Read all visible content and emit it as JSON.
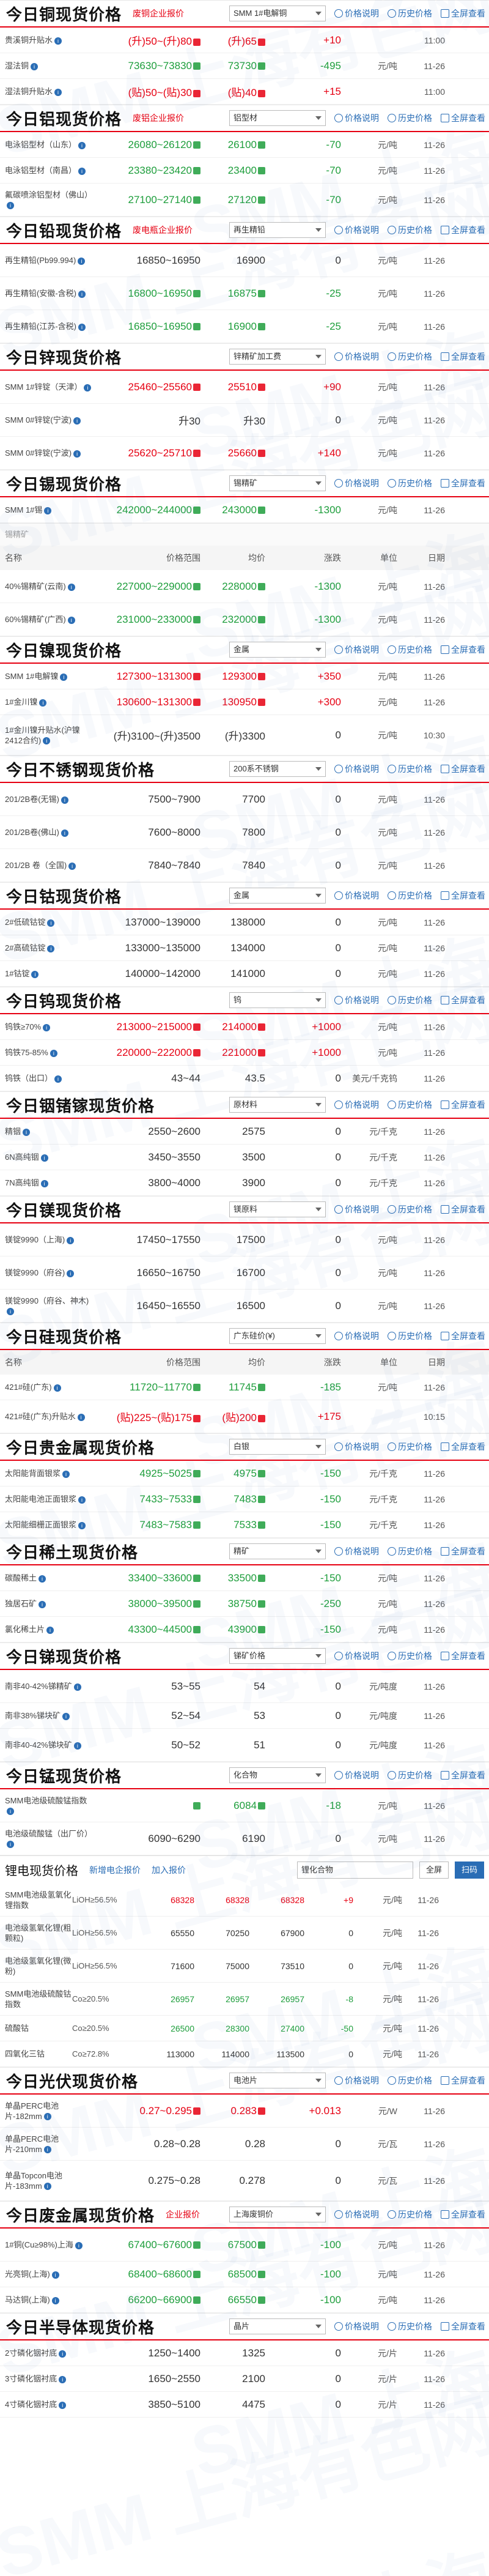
{
  "labels": {
    "price_desc": "价格说明",
    "history": "历史价格",
    "full_view": "全屏查看"
  },
  "sections": [
    {
      "title": "今日铜现货价格",
      "tag": "废铜企业报价",
      "select": "SMM 1#电解铜",
      "hdr": false,
      "rows": [
        {
          "name": "贵溪铜升贴水",
          "range": "(升)50~(升)80",
          "avg": "(升)65",
          "chg": "+10",
          "dir": "up",
          "unit": "",
          "date": "11:00"
        },
        {
          "name": "湿法铜",
          "range": "73630~73830",
          "avg": "73730",
          "chg": "-495",
          "dir": "down",
          "unit": "元/吨",
          "date": "11-26"
        },
        {
          "name": "湿法铜升贴水",
          "range": "(贴)50~(贴)30",
          "avg": "(贴)40",
          "chg": "+15",
          "dir": "up",
          "unit": "",
          "date": "11:00"
        }
      ]
    },
    {
      "title": "今日铝现货价格",
      "tag": "废铝企业报价",
      "select": "铝型材",
      "hdr": false,
      "rows": [
        {
          "name": "电泳铝型材（山东）",
          "range": "26080~26120",
          "avg": "26100",
          "chg": "-70",
          "dir": "down",
          "unit": "元/吨",
          "date": "11-26"
        },
        {
          "name": "电泳铝型材（南昌）",
          "range": "23380~23420",
          "avg": "23400",
          "chg": "-70",
          "dir": "down",
          "unit": "元/吨",
          "date": "11-26"
        },
        {
          "name": "氟碳喷涂铝型材（佛山）",
          "range": "27100~27140",
          "avg": "27120",
          "chg": "-70",
          "dir": "down",
          "unit": "元/吨",
          "date": "11-26"
        }
      ]
    },
    {
      "title": "今日铅现货价格",
      "tag": "废电瓶企业报价",
      "select": "再生精铅",
      "hdr": false,
      "rows": [
        {
          "name": "再生精铅(Pb99.994)",
          "range": "16850~16950",
          "avg": "16900",
          "chg": "0",
          "dir": "flat",
          "unit": "元/吨",
          "date": "11-26"
        },
        {
          "name": "再生精铅(安徽-含税)",
          "range": "16800~16950",
          "avg": "16875",
          "chg": "-25",
          "dir": "down",
          "unit": "元/吨",
          "date": "11-26"
        },
        {
          "name": "再生精铅(江苏-含税)",
          "range": "16850~16950",
          "avg": "16900",
          "chg": "-25",
          "dir": "down",
          "unit": "元/吨",
          "date": "11-26"
        }
      ]
    },
    {
      "title": "今日锌现货价格",
      "tag": "",
      "select": "锌精矿加工费",
      "hdr": false,
      "rows": [
        {
          "name": "SMM 1#锌锭（天津）",
          "range": "25460~25560",
          "avg": "25510",
          "chg": "+90",
          "dir": "up",
          "unit": "元/吨",
          "date": "11-26"
        },
        {
          "name": "SMM 0#锌锭(宁波)",
          "range": "升30",
          "avg": "升30",
          "chg": "0",
          "dir": "flat",
          "unit": "元/吨",
          "date": "11-26"
        },
        {
          "name": "SMM 0#锌锭(宁波)",
          "range": "25620~25710",
          "avg": "25660",
          "chg": "+140",
          "dir": "up",
          "unit": "元/吨",
          "date": "11-26"
        }
      ]
    },
    {
      "title": "今日锡现货价格",
      "tag": "",
      "select": "锡精矿",
      "hdr": false,
      "rows": [
        {
          "name": "SMM 1#锡",
          "range": "242000~244000",
          "avg": "243000",
          "chg": "-1300",
          "dir": "down",
          "unit": "元/吨",
          "date": "11-26"
        }
      ]
    },
    {
      "title": "",
      "tag": "",
      "select": "",
      "hdr": true,
      "sub": "锡精矿",
      "rows": [
        {
          "name": "40%锡精矿(云南)",
          "range": "227000~229000",
          "avg": "228000",
          "chg": "-1300",
          "dir": "down",
          "unit": "元/吨",
          "date": "11-26"
        },
        {
          "name": "60%锡精矿(广西)",
          "range": "231000~233000",
          "avg": "232000",
          "chg": "-1300",
          "dir": "down",
          "unit": "元/吨",
          "date": "11-26"
        }
      ]
    },
    {
      "title": "今日镍现货价格",
      "tag": "",
      "select": "金属",
      "hdr": false,
      "rows": [
        {
          "name": "SMM 1#电解镍",
          "range": "127300~131300",
          "avg": "129300",
          "chg": "+350",
          "dir": "up",
          "unit": "元/吨",
          "date": "11-26"
        },
        {
          "name": "1#金川镍",
          "range": "130600~131300",
          "avg": "130950",
          "chg": "+300",
          "dir": "up",
          "unit": "元/吨",
          "date": "11-26"
        },
        {
          "name": "1#金川镍升贴水(沪镍2412合约)",
          "range": "(升)3100~(升)3500",
          "avg": "(升)3300",
          "chg": "0",
          "dir": "flat",
          "unit": "元/吨",
          "date": "10:30"
        }
      ]
    },
    {
      "title": "今日不锈钢现货价格",
      "tag": "",
      "select": "200系不锈钢",
      "hdr": false,
      "rows": [
        {
          "name": "201/2B卷(无锡)",
          "range": "7500~7900",
          "avg": "7700",
          "chg": "0",
          "dir": "flat",
          "unit": "元/吨",
          "date": "11-26"
        },
        {
          "name": "201/2B卷(佛山)",
          "range": "7600~8000",
          "avg": "7800",
          "chg": "0",
          "dir": "flat",
          "unit": "元/吨",
          "date": "11-26"
        },
        {
          "name": "201/2B 卷（全国)",
          "range": "7840~7840",
          "avg": "7840",
          "chg": "0",
          "dir": "flat",
          "unit": "元/吨",
          "date": "11-26"
        }
      ]
    },
    {
      "title": "今日钴现货价格",
      "tag": "",
      "select": "金属",
      "hdr": false,
      "rows": [
        {
          "name": "2#低硫钴锭",
          "range": "137000~139000",
          "avg": "138000",
          "chg": "0",
          "dir": "flat",
          "unit": "元/吨",
          "date": "11-26"
        },
        {
          "name": "2#高硫钴锭",
          "range": "133000~135000",
          "avg": "134000",
          "chg": "0",
          "dir": "flat",
          "unit": "元/吨",
          "date": "11-26"
        },
        {
          "name": "1#钴锭",
          "range": "140000~142000",
          "avg": "141000",
          "chg": "0",
          "dir": "flat",
          "unit": "元/吨",
          "date": "11-26"
        }
      ]
    },
    {
      "title": "今日钨现货价格",
      "tag": "",
      "select": "钨",
      "hdr": false,
      "rows": [
        {
          "name": "钨铁≥70%",
          "range": "213000~215000",
          "avg": "214000",
          "chg": "+1000",
          "dir": "up",
          "unit": "元/吨",
          "date": "11-26"
        },
        {
          "name": "钨铁75-85%",
          "range": "220000~222000",
          "avg": "221000",
          "chg": "+1000",
          "dir": "up",
          "unit": "元/吨",
          "date": "11-26"
        },
        {
          "name": "钨铁（出口）",
          "range": "43~44",
          "avg": "43.5",
          "chg": "0",
          "dir": "flat",
          "unit": "美元/千克钨",
          "date": "11-26"
        }
      ]
    },
    {
      "title": "今日铟锗镓现货价格",
      "tag": "",
      "select": "原材料",
      "hdr": false,
      "rows": [
        {
          "name": "精铟",
          "range": "2550~2600",
          "avg": "2575",
          "chg": "0",
          "dir": "flat",
          "unit": "元/千克",
          "date": "11-26"
        },
        {
          "name": "6N高纯铟",
          "range": "3450~3550",
          "avg": "3500",
          "chg": "0",
          "dir": "flat",
          "unit": "元/千克",
          "date": "11-26"
        },
        {
          "name": "7N高纯铟",
          "range": "3800~4000",
          "avg": "3900",
          "chg": "0",
          "dir": "flat",
          "unit": "元/千克",
          "date": "11-26"
        }
      ]
    },
    {
      "title": "今日镁现货价格",
      "tag": "",
      "select": "镁原料",
      "hdr": false,
      "rows": [
        {
          "name": "镁锭9990（上海)",
          "range": "17450~17550",
          "avg": "17500",
          "chg": "0",
          "dir": "flat",
          "unit": "元/吨",
          "date": "11-26"
        },
        {
          "name": "镁锭9990（府谷)",
          "range": "16650~16750",
          "avg": "16700",
          "chg": "0",
          "dir": "flat",
          "unit": "元/吨",
          "date": "11-26"
        },
        {
          "name": "镁锭9990（府谷、神木)",
          "range": "16450~16550",
          "avg": "16500",
          "chg": "0",
          "dir": "flat",
          "unit": "元/吨",
          "date": "11-26"
        }
      ]
    },
    {
      "title": "今日硅现货价格",
      "tag": "",
      "select": "广东硅价(¥)",
      "hdr": true,
      "rows": [
        {
          "name": "421#硅(广东)",
          "range": "11720~11770",
          "avg": "11745",
          "chg": "-185",
          "dir": "down",
          "unit": "元/吨",
          "date": "11-26"
        },
        {
          "name": "421#硅(广东)升贴水",
          "range": "(贴)225~(贴)175",
          "avg": "(贴)200",
          "chg": "+175",
          "dir": "up",
          "unit": "",
          "date": "10:15"
        }
      ]
    },
    {
      "title": "今日贵金属现货价格",
      "tag": "",
      "select": "白银",
      "hdr": false,
      "rows": [
        {
          "name": "太阳能背面银浆",
          "range": "4925~5025",
          "avg": "4975",
          "chg": "-150",
          "dir": "down",
          "unit": "元/千克",
          "date": "11-26"
        },
        {
          "name": "太阳能电池正面银浆",
          "range": "7433~7533",
          "avg": "7483",
          "chg": "-150",
          "dir": "down",
          "unit": "元/千克",
          "date": "11-26"
        },
        {
          "name": "太阳能细栅正面银浆",
          "range": "7483~7583",
          "avg": "7533",
          "chg": "-150",
          "dir": "down",
          "unit": "元/千克",
          "date": "11-26"
        }
      ]
    },
    {
      "title": "今日稀土现货价格",
      "tag": "",
      "select": "精矿",
      "hdr": false,
      "rows": [
        {
          "name": "碳酸稀土",
          "range": "33400~33600",
          "avg": "33500",
          "chg": "-150",
          "dir": "down",
          "unit": "元/吨",
          "date": "11-26"
        },
        {
          "name": "独居石矿",
          "range": "38000~39500",
          "avg": "38750",
          "chg": "-250",
          "dir": "down",
          "unit": "元/吨",
          "date": "11-26"
        },
        {
          "name": "氯化稀土片",
          "range": "43300~44500",
          "avg": "43900",
          "chg": "-150",
          "dir": "down",
          "unit": "元/吨",
          "date": "11-26"
        }
      ]
    },
    {
      "title": "今日锑现货价格",
      "tag": "",
      "select": "锑矿价格",
      "hdr": false,
      "rows": [
        {
          "name": "南非40-42%锑精矿",
          "range": "53~55",
          "avg": "54",
          "chg": "0",
          "dir": "flat",
          "unit": "元/吨度",
          "date": "11-26"
        },
        {
          "name": "南非38%锑块矿",
          "range": "52~54",
          "avg": "53",
          "chg": "0",
          "dir": "flat",
          "unit": "元/吨度",
          "date": "11-26"
        },
        {
          "name": "南非40-42%锑块矿",
          "range": "50~52",
          "avg": "51",
          "chg": "0",
          "dir": "flat",
          "unit": "元/吨度",
          "date": "11-26"
        }
      ]
    },
    {
      "title": "今日锰现货价格",
      "tag": "",
      "select": "化合物",
      "hdr": false,
      "rows": [
        {
          "name": "SMM电池级硫酸锰指数",
          "range": "",
          "avg": "6084",
          "chg": "-18",
          "dir": "down",
          "unit": "元/吨",
          "date": "11-26"
        },
        {
          "name": "电池级硫酸锰（出厂价）",
          "range": "6090~6290",
          "avg": "6190",
          "chg": "0",
          "dir": "flat",
          "unit": "元/吨",
          "date": "11-26"
        }
      ]
    }
  ],
  "lithium": {
    "title": "锂电现货价格",
    "links": [
      "新增电企报价",
      "加入报价"
    ],
    "select": "锂化合物",
    "btn1": "全屏",
    "btn2": "扫码",
    "rows": [
      {
        "name": "SMM电池级氢氧化锂指数",
        "spec": "LiOH≥56.5%",
        "a": "68328",
        "b": "68328",
        "c": "68328",
        "chg": "+9",
        "dir": "up",
        "unit": "元/吨",
        "date": "11-26"
      },
      {
        "name": "电池级氢氧化锂(粗颗粒)",
        "spec": "LiOH≥56.5%",
        "a": "65550",
        "b": "70250",
        "c": "67900",
        "chg": "0",
        "dir": "flat",
        "unit": "元/吨",
        "date": "11-26"
      },
      {
        "name": "电池级氢氧化锂(微粉)",
        "spec": "LiOH≥56.5%",
        "a": "71600",
        "b": "75000",
        "c": "73510",
        "chg": "0",
        "dir": "flat",
        "unit": "元/吨",
        "date": "11-26"
      },
      {
        "name": "SMM电池级硫酸钴指数",
        "spec": "Co≥20.5%",
        "a": "26957",
        "b": "26957",
        "c": "26957",
        "chg": "-8",
        "dir": "down",
        "unit": "元/吨",
        "date": "11-26"
      },
      {
        "name": "硫酸钴",
        "spec": "Co≥20.5%",
        "a": "26500",
        "b": "28300",
        "c": "27400",
        "chg": "-50",
        "dir": "down",
        "unit": "元/吨",
        "date": "11-26"
      },
      {
        "name": "四氧化三钴",
        "spec": "Co≥72.8%",
        "a": "113000",
        "b": "114000",
        "c": "113500",
        "chg": "0",
        "dir": "flat",
        "unit": "元/吨",
        "date": "11-26"
      }
    ]
  },
  "sections2": [
    {
      "title": "今日光伏现货价格",
      "tag": "",
      "select": "电池片",
      "hdr": false,
      "rows": [
        {
          "name": "单晶PERC电池片-182mm",
          "range": "0.27~0.295",
          "avg": "0.283",
          "chg": "+0.013",
          "dir": "up",
          "unit": "元/W",
          "date": "11-26"
        },
        {
          "name": "单晶PERC电池片-210mm",
          "range": "0.28~0.28",
          "avg": "0.28",
          "chg": "0",
          "dir": "flat",
          "unit": "元/瓦",
          "date": "11-26"
        },
        {
          "name": "单晶Topcon电池片-183mm",
          "range": "0.275~0.28",
          "avg": "0.278",
          "chg": "0",
          "dir": "flat",
          "unit": "元/瓦",
          "date": "11-26"
        }
      ]
    },
    {
      "title": "今日废金属现货价格",
      "tag": "企业报价",
      "select": "上海废铜价",
      "hdr": false,
      "rows": [
        {
          "name": "1#铜(Cu≥98%)上海",
          "range": "67400~67600",
          "avg": "67500",
          "chg": "-100",
          "dir": "down",
          "unit": "元/吨",
          "date": "11-26"
        },
        {
          "name": "光亮铜(上海)",
          "range": "68400~68600",
          "avg": "68500",
          "chg": "-100",
          "dir": "down",
          "unit": "元/吨",
          "date": "11-26"
        },
        {
          "name": "马达铜(上海)",
          "range": "66200~66900",
          "avg": "66550",
          "chg": "-100",
          "dir": "down",
          "unit": "元/吨",
          "date": "11-26"
        }
      ]
    },
    {
      "title": "今日半导体现货价格",
      "tag": "",
      "select": "晶片",
      "hdr": false,
      "rows": [
        {
          "name": "2寸磷化铟衬底",
          "range": "1250~1400",
          "avg": "1325",
          "chg": "0",
          "dir": "flat",
          "unit": "元/片",
          "date": "11-26"
        },
        {
          "name": "3寸磷化铟衬底",
          "range": "1650~2550",
          "avg": "2100",
          "chg": "0",
          "dir": "flat",
          "unit": "元/片",
          "date": "11-26"
        },
        {
          "name": "4寸磷化铟衬底",
          "range": "3850~5100",
          "avg": "4475",
          "chg": "0",
          "dir": "flat",
          "unit": "元/片",
          "date": "11-26"
        }
      ]
    }
  ],
  "table_header": {
    "name": "名称",
    "range": "价格范围",
    "avg": "均价",
    "chg": "涨跌",
    "unit": "单位",
    "date": "日期"
  },
  "watermark": "SMM 上海有色网"
}
